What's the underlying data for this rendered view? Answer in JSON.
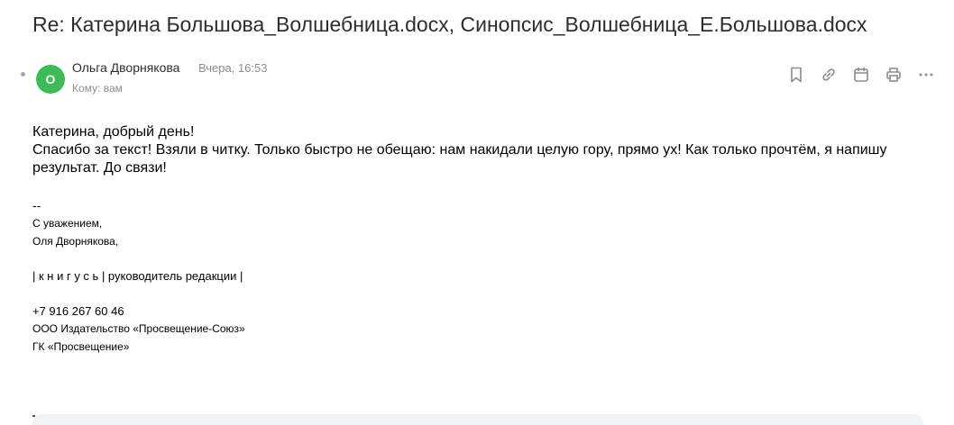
{
  "email": {
    "subject": "Re: Катерина Большова_Волшебница.docx, Синопсис_Волшебница_Е.Большова.docx",
    "sender_initial": "О",
    "sender_name": "Ольга Дворнякова",
    "time": "Вчера, 16:53",
    "recipient": "Кому: вам",
    "body_lines": [
      "Катерина, добрый день!",
      "Спасибо за текст! Взяли в читку. Только быстро не обещаю: нам накидали целую гору, прямо ух! Как только прочтём, я напишу результат. До связи!"
    ],
    "signature": {
      "separator": "--",
      "regards": "С уважением,",
      "name": "Оля Дворнякова,",
      "brand_line_prefix": "| ",
      "brand": "к н и г у с ь",
      "brand_line_suffix": " | руководитель редакции |",
      "phone": "+7 916 267 60 46",
      "company": "ООО Издательство «Просвещение-Союз»",
      "group": "ГК «Просвещение»"
    }
  },
  "toolbar": {
    "icons": [
      "bookmark-icon",
      "link-icon",
      "calendar-icon",
      "print-icon",
      "more-icon"
    ]
  },
  "colors": {
    "avatar": "#3dbb57",
    "muted": "#8c8c8c",
    "icon": "#8c8c8c"
  }
}
